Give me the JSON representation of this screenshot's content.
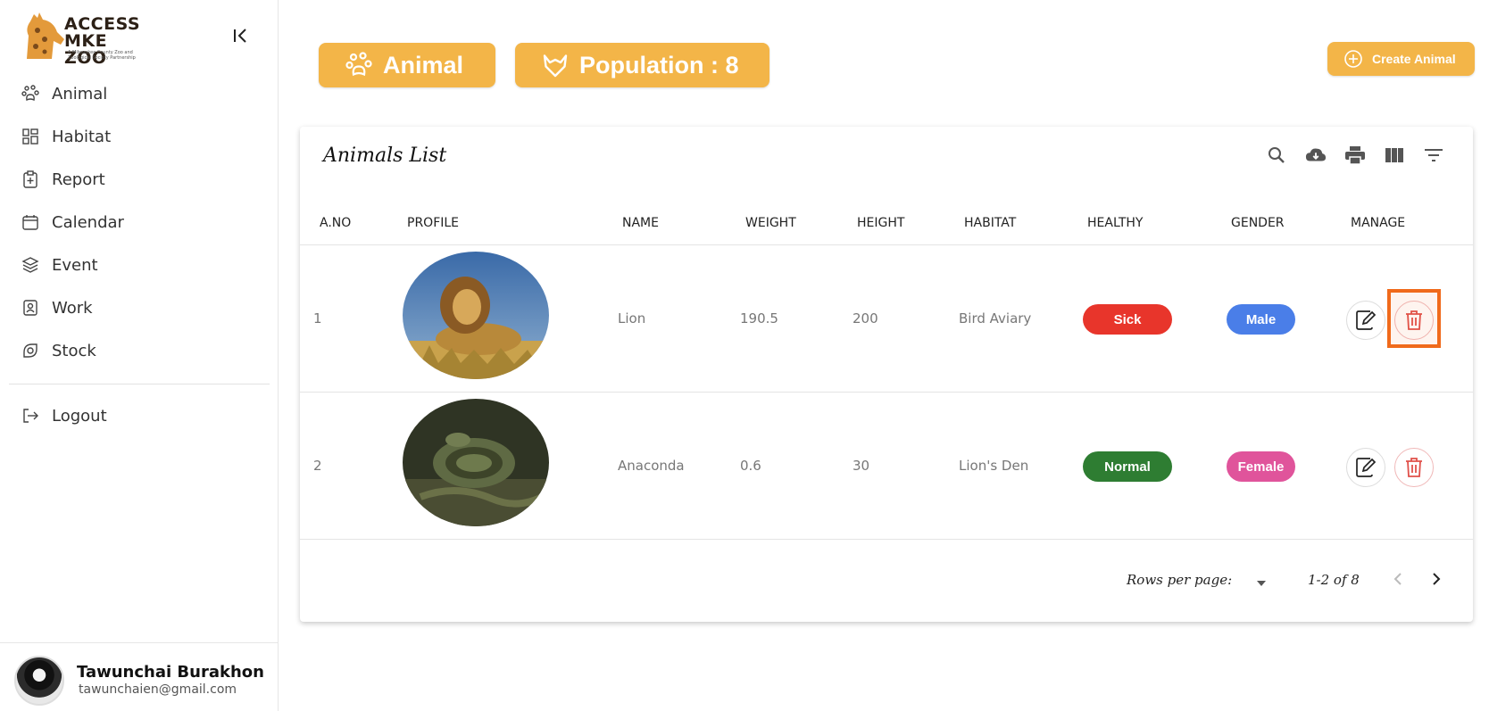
{
  "sidebar": {
    "logo": {
      "line1": "ACCESS",
      "line2": "MKE ZOO",
      "tagline": "A Milwaukee County Zoo and Zoological Society Partnership"
    },
    "items": [
      {
        "label": "Animal",
        "icon": "paw-icon"
      },
      {
        "label": "Habitat",
        "icon": "grid-icon"
      },
      {
        "label": "Report",
        "icon": "clipboard-icon"
      },
      {
        "label": "Calendar",
        "icon": "calendar-icon"
      },
      {
        "label": "Event",
        "icon": "layers-icon"
      },
      {
        "label": "Work",
        "icon": "id-badge-icon"
      },
      {
        "label": "Stock",
        "icon": "box-icon"
      }
    ],
    "logout_label": "Logout",
    "user": {
      "name": "Tawunchai Burakhon",
      "email": "tawunchaien@gmail.com"
    }
  },
  "header": {
    "animal_chip": "Animal",
    "population_chip": "Population : 8",
    "create_button": "Create Animal"
  },
  "table": {
    "title": "Animals List",
    "columns": [
      "A.NO",
      "PROFILE",
      "NAME",
      "WEIGHT",
      "HEIGHT",
      "HABITAT",
      "HEALTHY",
      "GENDER",
      "MANAGE"
    ],
    "rows": [
      {
        "no": "1",
        "name": "Lion",
        "weight": "190.5",
        "height": "200",
        "habitat": "Bird Aviary",
        "healthy": "Sick",
        "gender": "Male"
      },
      {
        "no": "2",
        "name": "Anaconda",
        "weight": "0.6",
        "height": "30",
        "habitat": "Lion's Den",
        "healthy": "Normal",
        "gender": "Female"
      }
    ],
    "footer": {
      "rows_per_page_label": "Rows per page:",
      "page_info": "1-2 of 8"
    }
  },
  "colors": {
    "accent": "#f3b548",
    "sick": "#e8352b",
    "normal": "#2e7d32",
    "male": "#4a7ee8",
    "female": "#e0549b",
    "highlight": "#f06a1b"
  }
}
